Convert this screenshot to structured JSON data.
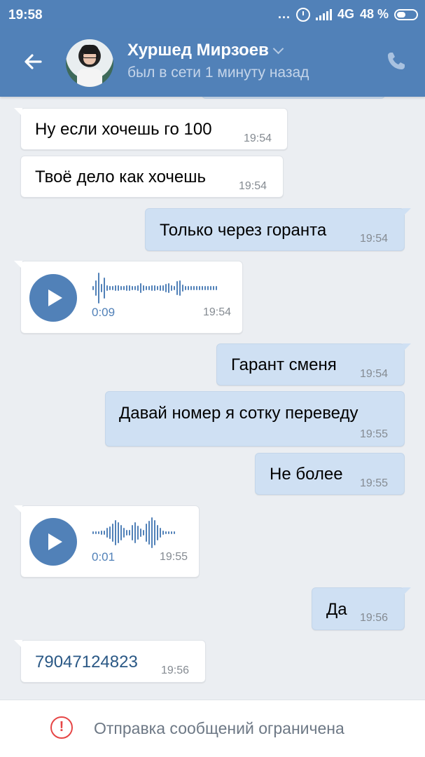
{
  "status_bar": {
    "time": "19:58",
    "dots": "...",
    "network": "4G",
    "battery_percent": "48 %",
    "battery_level": 0.48
  },
  "header": {
    "contact_name": "Хуршед Мирзоев",
    "last_seen": "был в сети 1 минуту назад"
  },
  "messages": [
    {
      "direction": "in",
      "type": "text",
      "text": "Ну если хочешь го 100",
      "time": "19:54"
    },
    {
      "direction": "in",
      "type": "text",
      "text": "Твоё дело как хочешь",
      "time": "19:54"
    },
    {
      "direction": "out",
      "type": "text",
      "text": "Только через горанта",
      "time": "19:54"
    },
    {
      "direction": "in",
      "type": "voice",
      "duration": "0:09",
      "time": "19:54"
    },
    {
      "direction": "out",
      "type": "text",
      "text": "Гарант сменя",
      "time": "19:54"
    },
    {
      "direction": "out",
      "type": "text",
      "text": "Давай номер я сотку переведу",
      "time": "19:55"
    },
    {
      "direction": "out",
      "type": "text",
      "text": "Не более",
      "time": "19:55"
    },
    {
      "direction": "in",
      "type": "voice",
      "duration": "0:01",
      "time": "19:55"
    },
    {
      "direction": "out",
      "type": "text",
      "text": "Да",
      "time": "19:56"
    },
    {
      "direction": "in",
      "type": "link",
      "text": "79047124823",
      "time": "19:56"
    }
  ],
  "bottom_bar": {
    "notice": "Отправка сообщений ограничена",
    "icon": "warning-icon"
  },
  "colors": {
    "header": "#5181b8",
    "incoming_bubble": "#ffffff",
    "outgoing_bubble": "#cfe0f3",
    "background": "#ebeef2",
    "warning": "#e64646"
  }
}
